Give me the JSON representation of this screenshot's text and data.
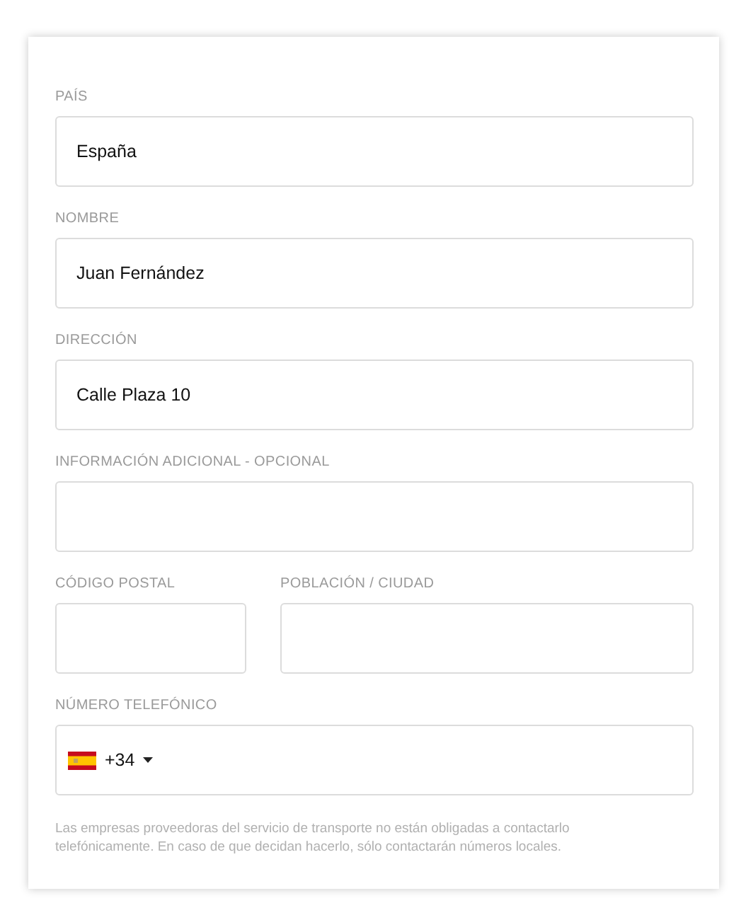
{
  "fields": [
    {
      "label": "PAÍS",
      "value": "España"
    },
    {
      "label": "NOMBRE",
      "value": "Juan Fernández"
    },
    {
      "label": "DIRECCIÓN",
      "value": "Calle Plaza 10"
    },
    {
      "label": "INFORMACIÓN ADICIONAL - OPCIONAL"
    }
  ],
  "split_fields": [
    {
      "label": "CÓDIGO POSTAL"
    },
    {
      "label": "POBLACIÓN / CIUDAD"
    }
  ],
  "phone": {
    "label": "NÚMERO TELEFÓNICO",
    "code": "+34"
  },
  "note": "Las empresas proveedoras del servicio de transporte no están obligadas a contactarlo telefónicamente. En caso de que decidan hacerlo, sólo contactarán números locales."
}
